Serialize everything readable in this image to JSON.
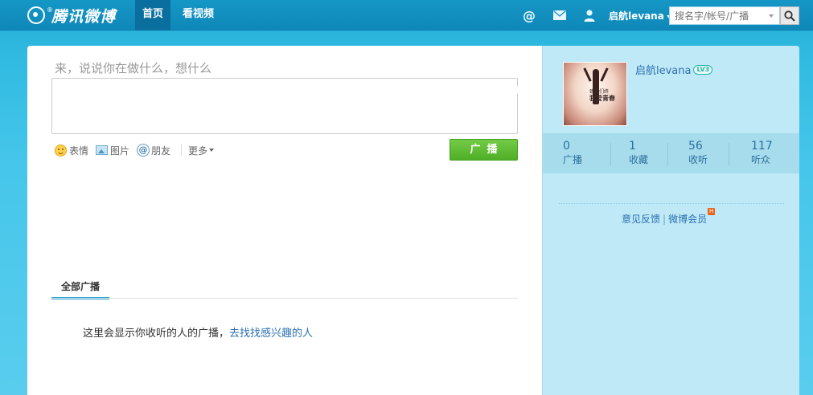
{
  "brand": {
    "logo_text": "腾讯微博",
    "logo_mark_sup": "®"
  },
  "nav": {
    "tabs": [
      {
        "label": "首页",
        "active": true
      },
      {
        "label": "看视频",
        "active": false
      }
    ]
  },
  "header": {
    "at_icon": "at-icon",
    "mail_icon": "mail-icon",
    "user_icon": "user-icon",
    "user_name": "启航levana",
    "search_placeholder": "搜名字/帐号/广播",
    "search_icon": "search-icon"
  },
  "compose": {
    "prompt": "来，说说你在做什么，想什么",
    "tools": {
      "emoji": "表情",
      "image": "图片",
      "friend": "朋友",
      "more": "更多"
    },
    "post_button": "广播"
  },
  "feed": {
    "tab_all": "全部广播",
    "empty_text": "这里会显示你收听的人的广播，",
    "empty_link": "去找找感兴趣的人"
  },
  "profile": {
    "name": "启航levana",
    "level_badge": "LV3",
    "avatar_caption_1": "致我们终",
    "avatar_caption_2": "我爱青春",
    "stats": [
      {
        "value": "0",
        "label": "广播"
      },
      {
        "value": "1",
        "label": "收藏"
      },
      {
        "value": "56",
        "label": "收听"
      },
      {
        "value": "117",
        "label": "听众"
      }
    ],
    "links": {
      "feedback": "意见反馈",
      "separator": "|",
      "vip": "微博会员",
      "vip_badge": "H"
    }
  },
  "colors": {
    "accent": "#2ba3d6",
    "post_button": "#5cba32",
    "link": "#2b6fb0",
    "side_bg": "#bfe9f7"
  }
}
